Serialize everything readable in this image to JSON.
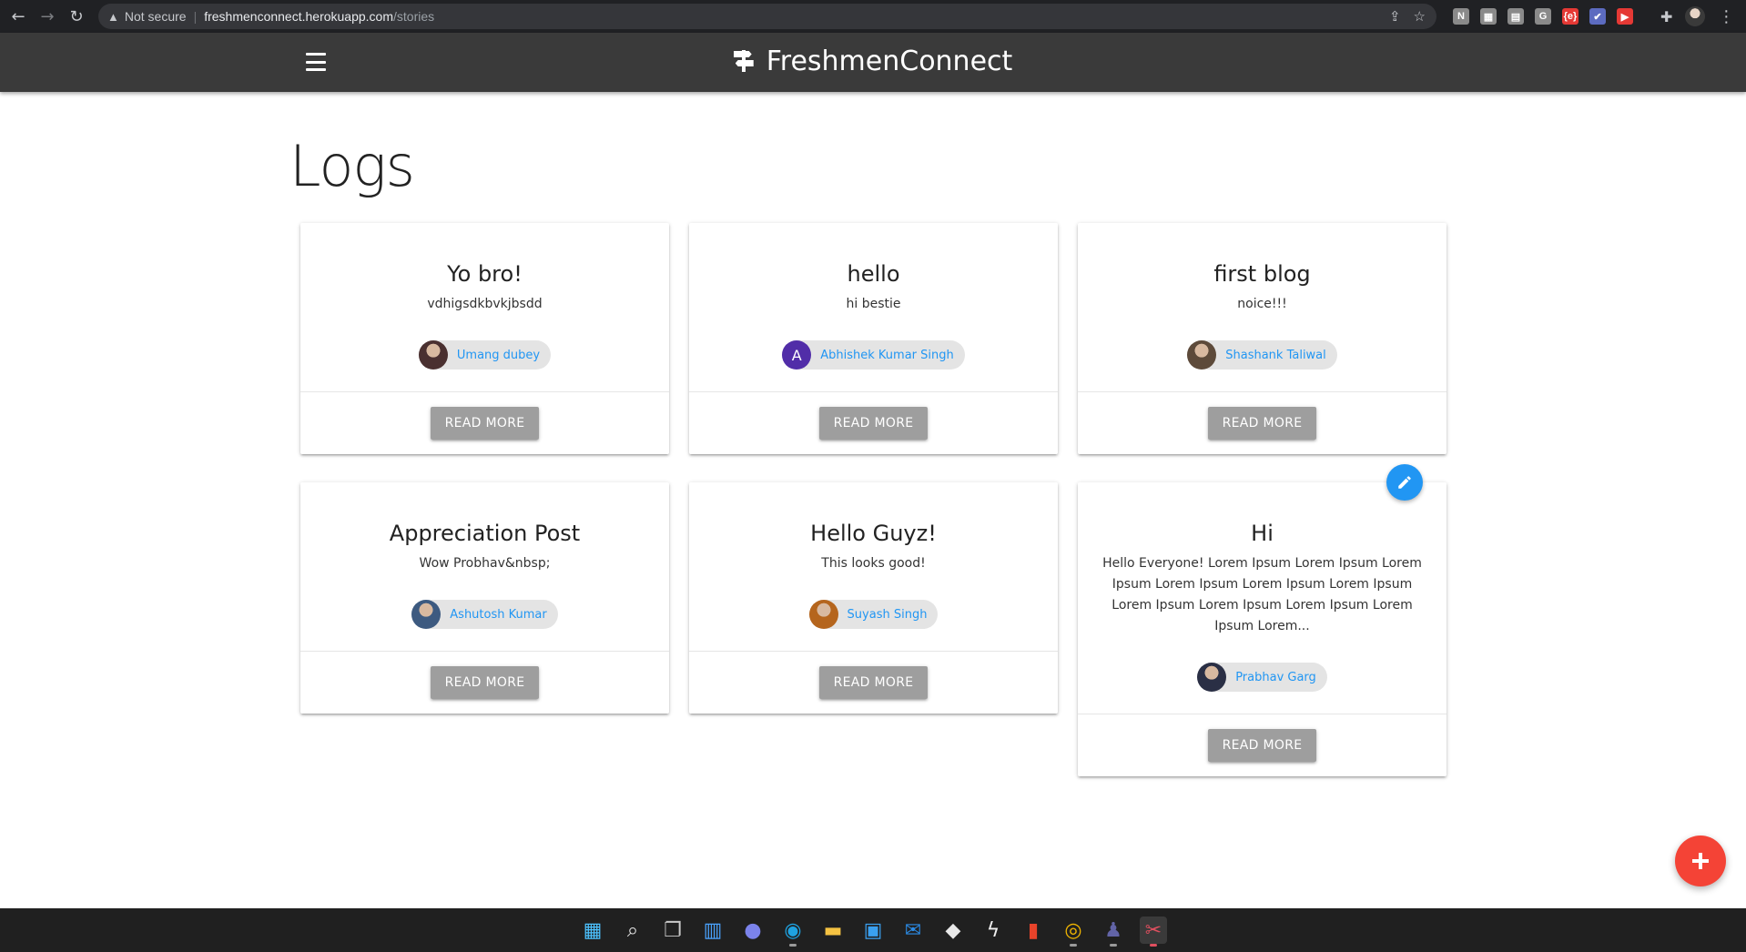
{
  "browser": {
    "security_label": "Not secure",
    "url_host": "freshmenconnect.herokuapp.com",
    "url_path": "/stories",
    "extensions": [
      {
        "name": "ext-1",
        "color": "#8a8a8a",
        "glyph": "N"
      },
      {
        "name": "ext-2",
        "color": "#8a8a8a",
        "glyph": "▦"
      },
      {
        "name": "ext-3",
        "color": "#8a8a8a",
        "glyph": "▤"
      },
      {
        "name": "ext-4",
        "color": "#8a8a8a",
        "glyph": "G"
      },
      {
        "name": "ext-5",
        "color": "#e53935",
        "glyph": "{e}"
      },
      {
        "name": "ext-6",
        "color": "#5c6bc0",
        "glyph": "✔"
      },
      {
        "name": "ext-7",
        "color": "#e53935",
        "glyph": "▶"
      }
    ]
  },
  "appbar": {
    "brand": "FreshmenConnect"
  },
  "page": {
    "title": "Logs"
  },
  "cards": [
    {
      "title": "Yo bro!",
      "body": "vdhigsdkbvkjbsdd",
      "author": "Umang dubey",
      "avatar_color": "#4a3030",
      "avatar_letter": "",
      "button": "READ MORE"
    },
    {
      "title": "hello",
      "body": "hi bestie",
      "author": "Abhishek Kumar Singh",
      "avatar_color": "#512da8",
      "avatar_letter": "A",
      "button": "READ MORE"
    },
    {
      "title": "first blog",
      "body": "noice!!!",
      "author": "Shashank Taliwal",
      "avatar_color": "#5d4a3a",
      "avatar_letter": "",
      "button": "READ MORE"
    },
    {
      "title": "Appreciation Post",
      "body": "Wow Probhav&nbsp;",
      "author": "Ashutosh Kumar",
      "avatar_color": "#3d5a80",
      "avatar_letter": "",
      "button": "READ MORE"
    },
    {
      "title": "Hello Guyz!",
      "body": "This looks good!",
      "author": "Suyash Singh",
      "avatar_color": "#b5651d",
      "avatar_letter": "",
      "button": "READ MORE"
    },
    {
      "title": "Hi",
      "body": "Hello Everyone! Lorem Ipsum Lorem Ipsum Lorem Ipsum Lorem Ipsum Lorem Ipsum Lorem Ipsum Lorem Ipsum Lorem Ipsum Lorem Ipsum Lorem Ipsum Lorem...",
      "author": "Prabhav Garg",
      "avatar_color": "#2a2f45",
      "avatar_letter": "",
      "button": "READ MORE"
    }
  ],
  "colors": {
    "appbar": "#3a3a3a",
    "chip_text": "#2196f3",
    "button": "#9e9e9e",
    "edit_fab": "#2196f3",
    "add_fab": "#f44336"
  },
  "taskbar": {
    "icons": [
      "windows-start-icon",
      "search-icon",
      "task-view-icon",
      "widgets-icon",
      "teams-chat-icon",
      "edge-icon",
      "file-explorer-icon",
      "store-icon",
      "mail-icon",
      "dropbox-icon",
      "zap-icon",
      "office-icon",
      "chrome-icon",
      "teams-icon",
      "snip-icon"
    ]
  }
}
